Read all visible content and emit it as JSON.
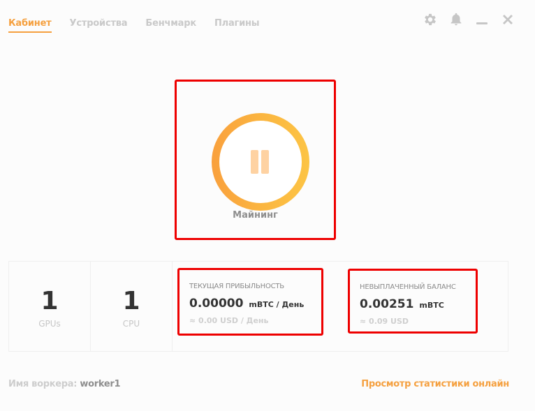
{
  "nav": {
    "tabs": [
      {
        "label": "Кабинет",
        "active": true
      },
      {
        "label": "Устройства",
        "active": false
      },
      {
        "label": "Бенчмарк",
        "active": false
      },
      {
        "label": "Плагины",
        "active": false
      }
    ]
  },
  "window_controls": [
    "gear-icon",
    "bell-icon",
    "minimize-icon",
    "close-icon"
  ],
  "mining": {
    "label": "Майнинг",
    "state": "paused",
    "icon": "pause-icon"
  },
  "devices": {
    "gpus": {
      "count": "1",
      "label": "GPUs"
    },
    "cpu": {
      "count": "1",
      "label": "CPU"
    }
  },
  "profit": {
    "title": "ТЕКУЩАЯ ПРИБЫЛЬНОСТЬ",
    "value": "0.00000",
    "unit": "mBTC / День",
    "usd": "≈ 0.00 USD / День"
  },
  "balance": {
    "title": "НЕВЫПЛАЧЕННЫЙ БАЛАНС",
    "value": "0.00251",
    "unit": "mBTC",
    "usd": "≈ 0.09 USD"
  },
  "footer": {
    "worker_label": "Имя воркера:",
    "worker_name": "worker1",
    "online_link": "Просмотр статистики онлайн"
  },
  "colors": {
    "accent": "#f5a03f",
    "highlight_border": "#ee0000",
    "ring_start": "#f9a03d",
    "ring_end": "#fcc445"
  }
}
